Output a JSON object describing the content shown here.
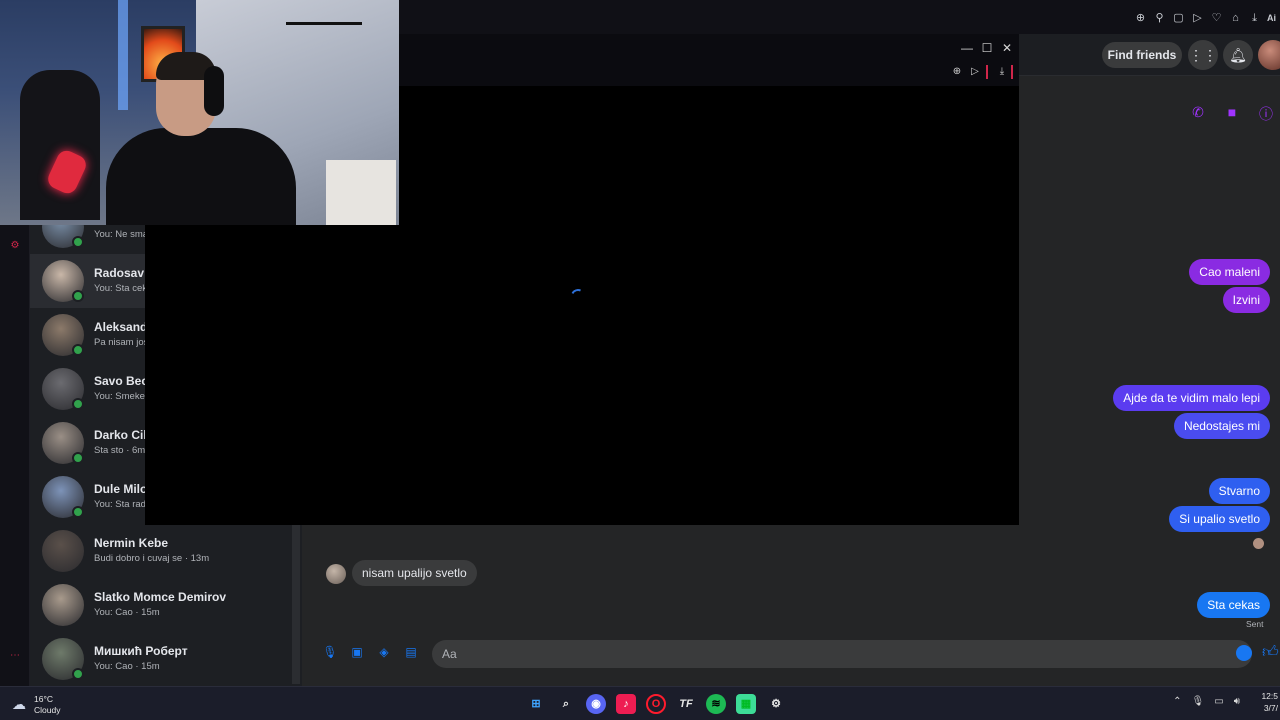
{
  "browser": {
    "toolbar_icons": [
      "zoom-icon",
      "pin-icon",
      "snapshot-icon",
      "play-icon",
      "heart-icon",
      "wallet-icon",
      "download-icon"
    ],
    "ai_label": "Ai"
  },
  "header": {
    "find_friends": "Find friends"
  },
  "chat_list": [
    {
      "name": "",
      "preview": "You: Ne sma",
      "online": true,
      "active": false
    },
    {
      "name": "Radosav S",
      "preview": "You: Sta cek",
      "online": true,
      "active": true
    },
    {
      "name": "Aleksanda",
      "preview": "Pa nisam jos",
      "online": true,
      "active": false
    },
    {
      "name": "Savo Beca",
      "preview": "You: Smeker",
      "online": true,
      "active": false
    },
    {
      "name": "Darko Cile",
      "preview": "Sta sto · 6m",
      "online": true,
      "active": false
    },
    {
      "name": "Dule Milov",
      "preview": "You: Sta rad",
      "online": true,
      "active": false
    },
    {
      "name": "Nermin Kebe",
      "preview": "Budi dobro i cuvaj se · 13m",
      "online": false,
      "active": false
    },
    {
      "name": "Slatko Momce Demirov",
      "preview": "You: Cao · 15m",
      "online": false,
      "active": false
    },
    {
      "name": "Мишкић Роберт",
      "preview": "You: Cao · 15m",
      "online": true,
      "active": false
    }
  ],
  "messages": {
    "sent": [
      {
        "text": "Cao maleni",
        "color": "#8a2be2"
      },
      {
        "text": "Izvini",
        "color": "#8a2be2"
      },
      {
        "text": "Ajde da te vidim malo lepi",
        "color": "#5b3cf0"
      },
      {
        "text": "Nedostajes mi",
        "color": "#4a4cf0"
      },
      {
        "text": "Stvarno",
        "color": "#2f5ff0"
      },
      {
        "text": "Si upalio svetlo",
        "color": "#2f5ff0"
      },
      {
        "text": "Sta cekas",
        "color": "#1877f2"
      }
    ],
    "received": "nisam upalijo svetlo",
    "status": "Sent"
  },
  "composer": {
    "placeholder": "Aa"
  },
  "taskbar": {
    "weather_temp": "16°C",
    "weather_condition": "Cloudy",
    "time": "12:5",
    "date": "3/7/"
  },
  "colors": {
    "accent_purple": "#a033ff",
    "messenger_blue": "#1877f2",
    "online_green": "#31a24c",
    "opera_red": "#d0264a"
  }
}
